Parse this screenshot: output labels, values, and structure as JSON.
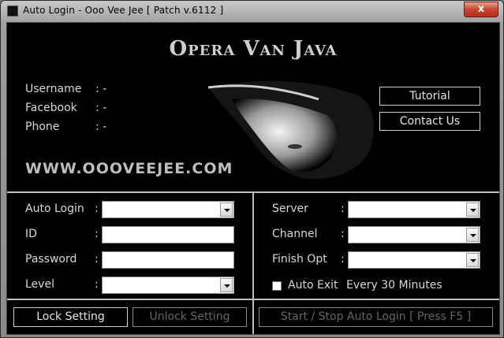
{
  "window": {
    "title": "Auto Login - Ooo Vee Jee [ Patch v.6112 ]",
    "close_label": "x"
  },
  "header": {
    "title": "Opera Van Java",
    "website": "WWW.OOOVEEJEE.COM",
    "info": [
      {
        "label": "Username",
        "sep": ": -"
      },
      {
        "label": "Facebook",
        "sep": ": -"
      },
      {
        "label": "Phone",
        "sep": ": -"
      }
    ],
    "tutorial_label": "Tutorial",
    "contact_label": "Contact Us"
  },
  "left_form": {
    "auto_login_label": "Auto Login",
    "id_label": "ID",
    "password_label": "Password",
    "level_label": "Level",
    "colon": ":",
    "auto_login_value": "",
    "id_value": "",
    "password_value": "",
    "level_value": ""
  },
  "right_form": {
    "server_label": "Server",
    "channel_label": "Channel",
    "finish_label": "Finish Opt",
    "colon": ":",
    "server_value": "",
    "channel_value": "",
    "finish_value": "",
    "auto_exit_label": "Auto Exit",
    "auto_exit_interval": "Every 30 Minutes",
    "auto_exit_checked": false
  },
  "footer": {
    "lock_label": "Lock Setting",
    "unlock_label": "Unlock Setting",
    "start_stop_label": "Start / Stop Auto Login [ Press F5 ]"
  },
  "colors": {
    "background": "#000000",
    "text": "#d8d8d8",
    "disabled_text": "#666666",
    "close_button": "#c8452f"
  }
}
